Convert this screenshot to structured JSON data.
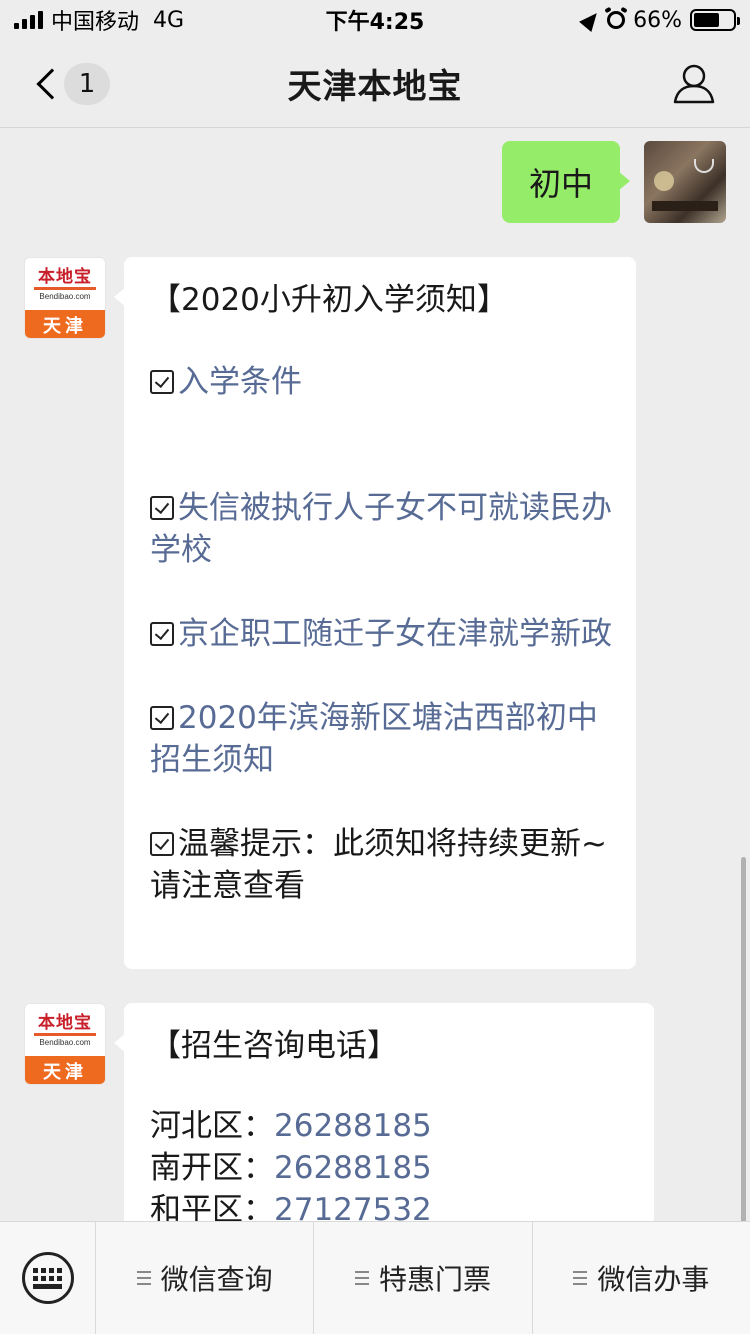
{
  "status_bar": {
    "carrier": "中国移动",
    "network": "4G",
    "time": "下午4:25",
    "battery": "66%",
    "battery_level": 0.66
  },
  "nav": {
    "unread_count": "1",
    "title": "天津本地宝"
  },
  "messages": {
    "user_message": "初中",
    "bot_avatar": {
      "logo": "本地宝",
      "logo_sub": "Bendibao.com",
      "city": "天津"
    },
    "card1": {
      "heading": "【2020小升初入学须知】",
      "items": [
        "入学条件",
        "失信被执行人子女不可就读民办学校",
        "京企职工随迁子女在津就学新政",
        "2020年滨海新区塘沽西部初中招生须知"
      ],
      "tip": "温馨提示：此须知将持续更新~请注意查看"
    },
    "card2": {
      "heading": "【招生咨询电话】",
      "phones": [
        {
          "district": "河北区：",
          "number": "26288185"
        },
        {
          "district": "南开区：",
          "number": "26288185"
        },
        {
          "district": "和平区：",
          "number": "27127532"
        }
      ]
    }
  },
  "bottom_menu": {
    "items": [
      "微信查询",
      "特惠门票",
      "微信办事"
    ]
  }
}
